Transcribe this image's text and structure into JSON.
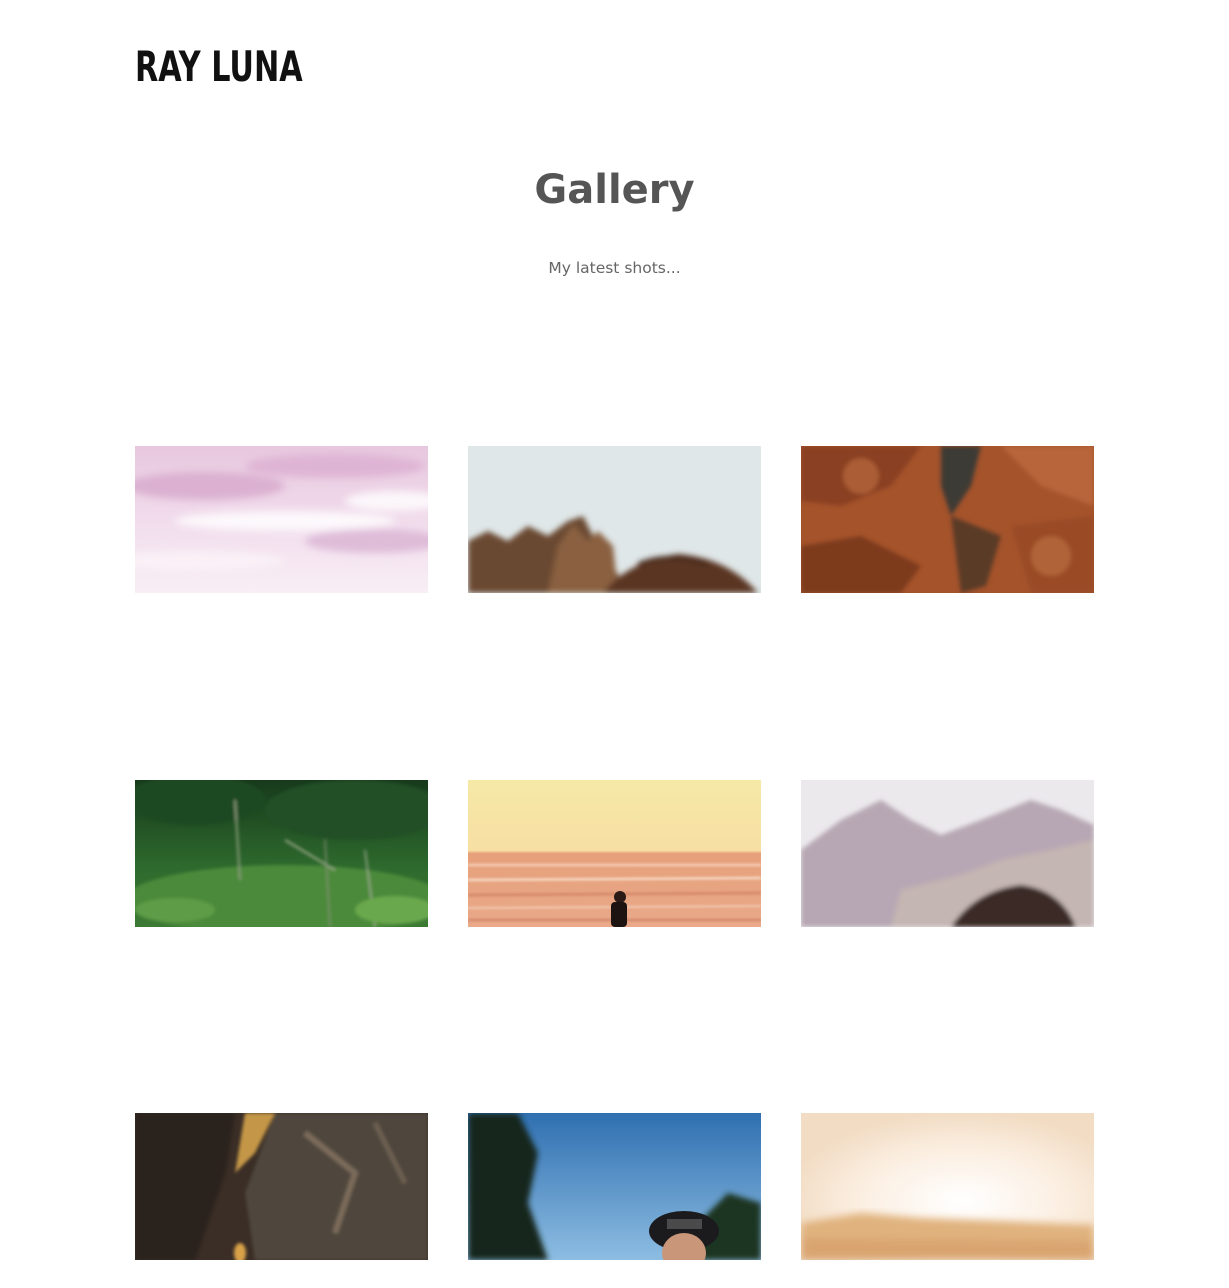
{
  "header": {
    "logo_text": "RAY LUNA"
  },
  "main": {
    "title": "Gallery",
    "subtitle": "My latest shots..."
  },
  "gallery": {
    "items": [
      {
        "subject": "pink clouds sky"
      },
      {
        "subject": "person hair against rocky cliff"
      },
      {
        "subject": "orange rock texture"
      },
      {
        "subject": "green grass and plants"
      },
      {
        "subject": "person on beach at sunset"
      },
      {
        "subject": "misty mountains and person"
      },
      {
        "subject": "dark rocky cliff in light"
      },
      {
        "subject": "portrait of man in cap with trees"
      },
      {
        "subject": "hazy sunlit hills"
      }
    ]
  },
  "colors": {
    "logo": "#111111",
    "title": "#555555",
    "subtitle": "#666666",
    "background": "#ffffff"
  }
}
